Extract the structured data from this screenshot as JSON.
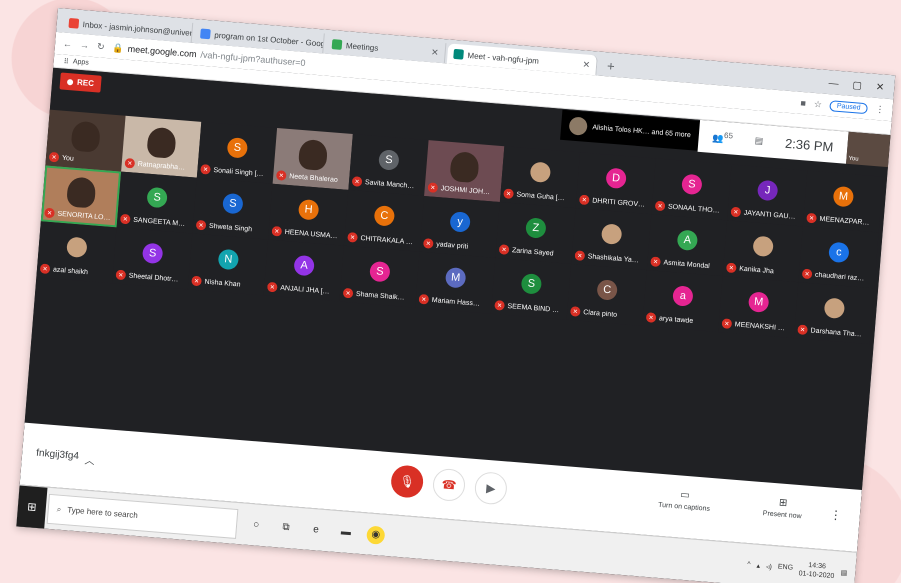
{
  "browser": {
    "tabs": [
      {
        "title": "Inbox - jasmin.johnson@univers…",
        "color": "#ea4335"
      },
      {
        "title": "program on 1st October - Goog…",
        "color": "#4285f4"
      },
      {
        "title": "Meetings",
        "color": "#34a853"
      },
      {
        "title": "Meet - vah-ngfu-jpm",
        "color": "#00897b"
      }
    ],
    "url_host": "meet.google.com",
    "url_path": "/vah-ngfu-jpm?authuser=0",
    "paused_label": "Paused",
    "bookmarks_label": "Apps"
  },
  "meet": {
    "rec_label": "REC",
    "presenter_text": "Alishia Tolos HK… and 65 more",
    "people_count": "65",
    "time": "2:36 PM",
    "self_label": "You",
    "meeting_code": "fnkgij3fg4",
    "captions_label": "Turn on captions",
    "present_label": "Present now",
    "participants": [
      {
        "name": "You",
        "kind": "video",
        "v": "v1"
      },
      {
        "name": "Ratnaprabha…",
        "kind": "video",
        "v": "v3"
      },
      {
        "name": "Sonali Singh […",
        "kind": "letter",
        "letter": "S",
        "color": "#e8710a"
      },
      {
        "name": "Neeta Bhalerao",
        "kind": "video",
        "v": "v4"
      },
      {
        "name": "Savita Manch…",
        "kind": "letter",
        "letter": "S",
        "color": "#5f6368"
      },
      {
        "name": "JOSHMI JOH…",
        "kind": "video",
        "v": "v5"
      },
      {
        "name": "Soma Guha […",
        "kind": "photo"
      },
      {
        "name": "DHRITI GROV…",
        "kind": "letter",
        "letter": "D",
        "color": "#e52592"
      },
      {
        "name": "SONAAL THO…",
        "kind": "letter",
        "letter": "S",
        "color": "#e52592"
      },
      {
        "name": "JAYANTI GAU…",
        "kind": "letter",
        "letter": "J",
        "color": "#7627bb"
      },
      {
        "name": "MEENAZPAR…",
        "kind": "letter",
        "letter": "M",
        "color": "#e8710a"
      },
      {
        "name": "SENORITA LO…",
        "kind": "video",
        "v": "v2",
        "active": true
      },
      {
        "name": "SANGEETA M…",
        "kind": "letter",
        "letter": "S",
        "color": "#34a853"
      },
      {
        "name": "Shweta Singh",
        "kind": "letter",
        "letter": "S",
        "color": "#1967d2"
      },
      {
        "name": "HEENA USMA…",
        "kind": "letter",
        "letter": "H",
        "color": "#e8710a"
      },
      {
        "name": "CHITRAKALA …",
        "kind": "letter",
        "letter": "C",
        "color": "#e8710a"
      },
      {
        "name": "yadav priti",
        "kind": "letter",
        "letter": "y",
        "color": "#1967d2"
      },
      {
        "name": "Zarina Sayed",
        "kind": "letter",
        "letter": "Z",
        "color": "#1e8e3e"
      },
      {
        "name": "Shashikala Ya…",
        "kind": "photo"
      },
      {
        "name": "Asmita Mondal",
        "kind": "letter",
        "letter": "A",
        "color": "#34a853"
      },
      {
        "name": "Kanika Jha",
        "kind": "photo"
      },
      {
        "name": "chaudhari raz…",
        "kind": "letter",
        "letter": "c",
        "color": "#1a73e8"
      },
      {
        "name": "azal shaikh",
        "kind": "photo"
      },
      {
        "name": "Sheetal Dhotr…",
        "kind": "letter",
        "letter": "S",
        "color": "#9334e6"
      },
      {
        "name": "Nisha Khan",
        "kind": "letter",
        "letter": "N",
        "color": "#12a4af"
      },
      {
        "name": "ANJALI JHA […",
        "kind": "letter",
        "letter": "A",
        "color": "#9334e6"
      },
      {
        "name": "Shama Shaik…",
        "kind": "letter",
        "letter": "S",
        "color": "#e52592"
      },
      {
        "name": "Mariam Hass…",
        "kind": "letter",
        "letter": "M",
        "color": "#5c6bc0"
      },
      {
        "name": "SEEMA BIND …",
        "kind": "letter",
        "letter": "S",
        "color": "#1e8e3e"
      },
      {
        "name": "Clara pinto",
        "kind": "letter",
        "letter": "C",
        "color": "#795548"
      },
      {
        "name": "arya tawde",
        "kind": "letter",
        "letter": "a",
        "color": "#e52592"
      },
      {
        "name": "MEENAKSHI …",
        "kind": "letter",
        "letter": "M",
        "color": "#e52592"
      },
      {
        "name": "Darshana Tha…",
        "kind": "photo"
      }
    ]
  },
  "taskbar": {
    "search_placeholder": "Type here to search",
    "lang": "ENG",
    "time": "14:36",
    "date": "01-10-2020"
  }
}
